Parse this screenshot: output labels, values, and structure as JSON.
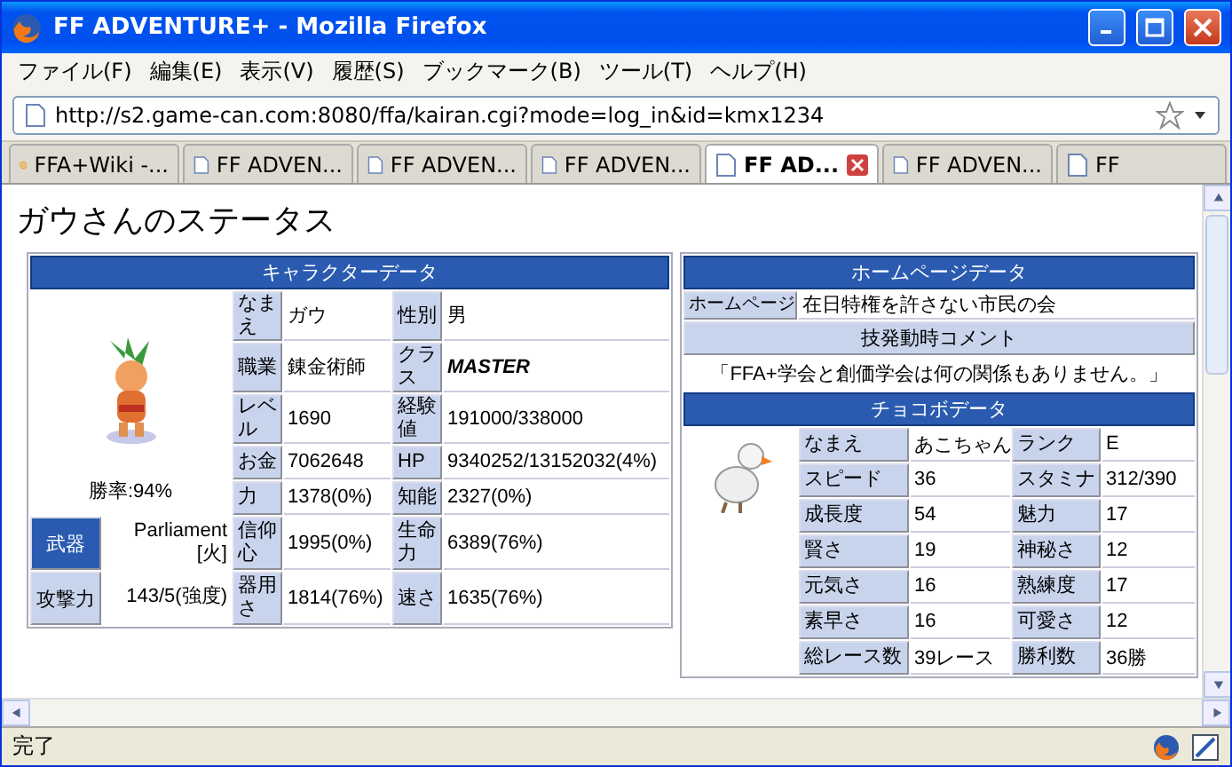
{
  "window": {
    "title": "FF ADVENTURE+ - Mozilla Firefox"
  },
  "menu": [
    "ファイル(F)",
    "編集(E)",
    "表示(V)",
    "履歴(S)",
    "ブックマーク(B)",
    "ツール(T)",
    "ヘルプ(H)"
  ],
  "address": {
    "url": "http://s2.game-can.com:8080/ffa/kairan.cgi?mode=log_in&id=kmx1234"
  },
  "tabs": [
    {
      "label": "FFA+Wiki -...",
      "kind": "wiki",
      "selected": false
    },
    {
      "label": "FF ADVEN...",
      "kind": "page",
      "selected": false
    },
    {
      "label": "FF ADVEN...",
      "kind": "page",
      "selected": false
    },
    {
      "label": "FF ADVEN...",
      "kind": "page",
      "selected": false
    },
    {
      "label": "FF AD...",
      "kind": "page",
      "selected": true
    },
    {
      "label": "FF ADVEN...",
      "kind": "page",
      "selected": false
    },
    {
      "label": "FF",
      "kind": "page",
      "selected": false
    }
  ],
  "page": {
    "heading": "ガウさんのステータス",
    "character": {
      "header": "キャラクターデータ",
      "win_rate": "勝率:94%",
      "stats": [
        {
          "label": "なまえ",
          "value": "ガウ",
          "label2": "性別",
          "value2": "男"
        },
        {
          "label": "職業",
          "value": "錬金術師",
          "label2": "クラス",
          "value2": "MASTER"
        },
        {
          "label": "レベル",
          "value": "1690",
          "label2": "経験値",
          "value2": "191000/338000"
        },
        {
          "label": "お金",
          "value": "7062648",
          "label2": "HP",
          "value2": "9340252/13152032(4%)"
        },
        {
          "label": "力",
          "value": "1378(0%)",
          "label2": "知能",
          "value2": "2327(0%)"
        }
      ],
      "equipment": [
        {
          "tag": "武器",
          "highlight": true,
          "item": "Parliament [火]",
          "label": "信仰心",
          "value": "1995(0%)",
          "label2": "生命力",
          "value2": "6389(76%)"
        },
        {
          "tag": "攻撃力",
          "highlight": false,
          "item": "143/5(強度)",
          "label": "器用さ",
          "value": "1814(76%)",
          "label2": "速さ",
          "value2": "1635(76%)"
        }
      ]
    },
    "homepage": {
      "header": "ホームページデータ",
      "label": "ホームページ",
      "value": "在日特権を許さない市民の会"
    },
    "comment": {
      "header": "技発動時コメント",
      "text": "「FFA+学会と創価学会は何の関係もありません。」"
    },
    "chocobo": {
      "header": "チョコボデータ",
      "rows": [
        {
          "label": "なまえ",
          "value": "あこちゃん",
          "label2": "ランク",
          "value2": "E"
        },
        {
          "label": "スピード",
          "value": "36",
          "label2": "スタミナ",
          "value2": "312/390"
        },
        {
          "label": "成長度",
          "value": "54",
          "label2": "魅力",
          "value2": "17"
        },
        {
          "label": "賢さ",
          "value": "19",
          "label2": "神秘さ",
          "value2": "12"
        },
        {
          "label": "元気さ",
          "value": "16",
          "label2": "熟練度",
          "value2": "17"
        },
        {
          "label": "素早さ",
          "value": "16",
          "label2": "可愛さ",
          "value2": "12"
        },
        {
          "label": "総レース数",
          "value": "39レース",
          "label2": "勝利数",
          "value2": "36勝"
        }
      ]
    }
  },
  "status_bar": {
    "text": "完了"
  }
}
